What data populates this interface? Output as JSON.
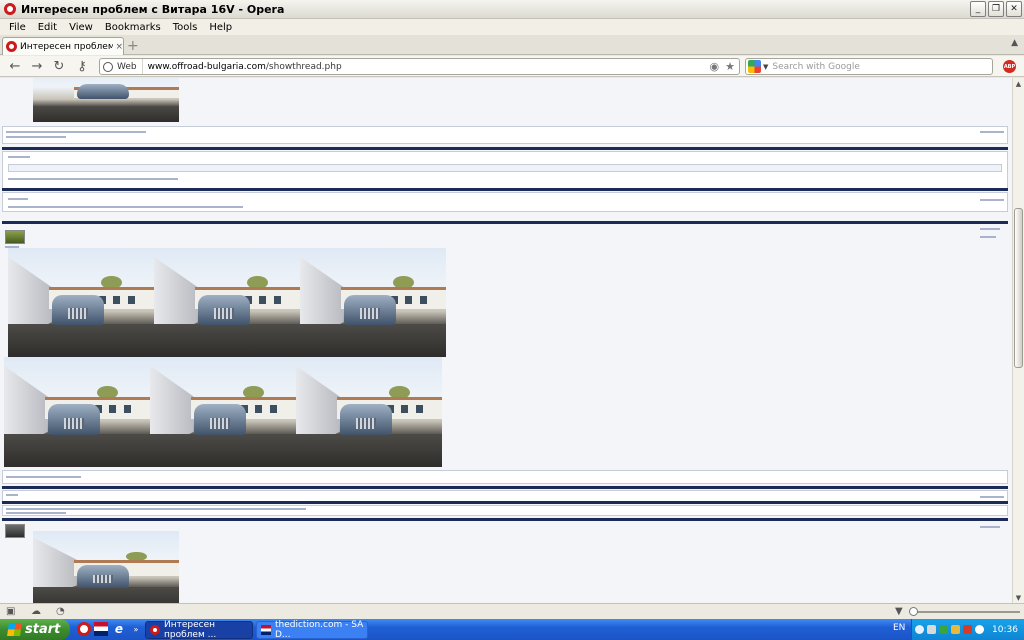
{
  "window": {
    "title": "Интересен проблем с Витара 16V - Opera",
    "controls": [
      "minimize",
      "restore",
      "close"
    ]
  },
  "menu": [
    "File",
    "Edit",
    "View",
    "Bookmarks",
    "Tools",
    "Help"
  ],
  "tabs": [
    {
      "label": "Интересен проблем с В...",
      "close": "×"
    }
  ],
  "nav": {
    "web_label": "Web",
    "url_domain": "www.offroad-bulgaria.com",
    "url_path": "/showthread.php",
    "search_placeholder": "Search with Google",
    "adblock_label": "ABP"
  },
  "taskbar": {
    "start_label": "start",
    "tasks": [
      {
        "label": "Интересен проблем ...",
        "active": true
      },
      {
        "label": "thediction.com - SA D...",
        "active": false
      }
    ],
    "language": "EN",
    "clock": "10:36"
  },
  "colors": {
    "post_separator": "#1b2a56",
    "content_bg": "#f4f5f9",
    "taskbar_blue": "#1f5fd5",
    "start_green": "#3c8c2e",
    "opera_red": "#cc1b1b"
  }
}
